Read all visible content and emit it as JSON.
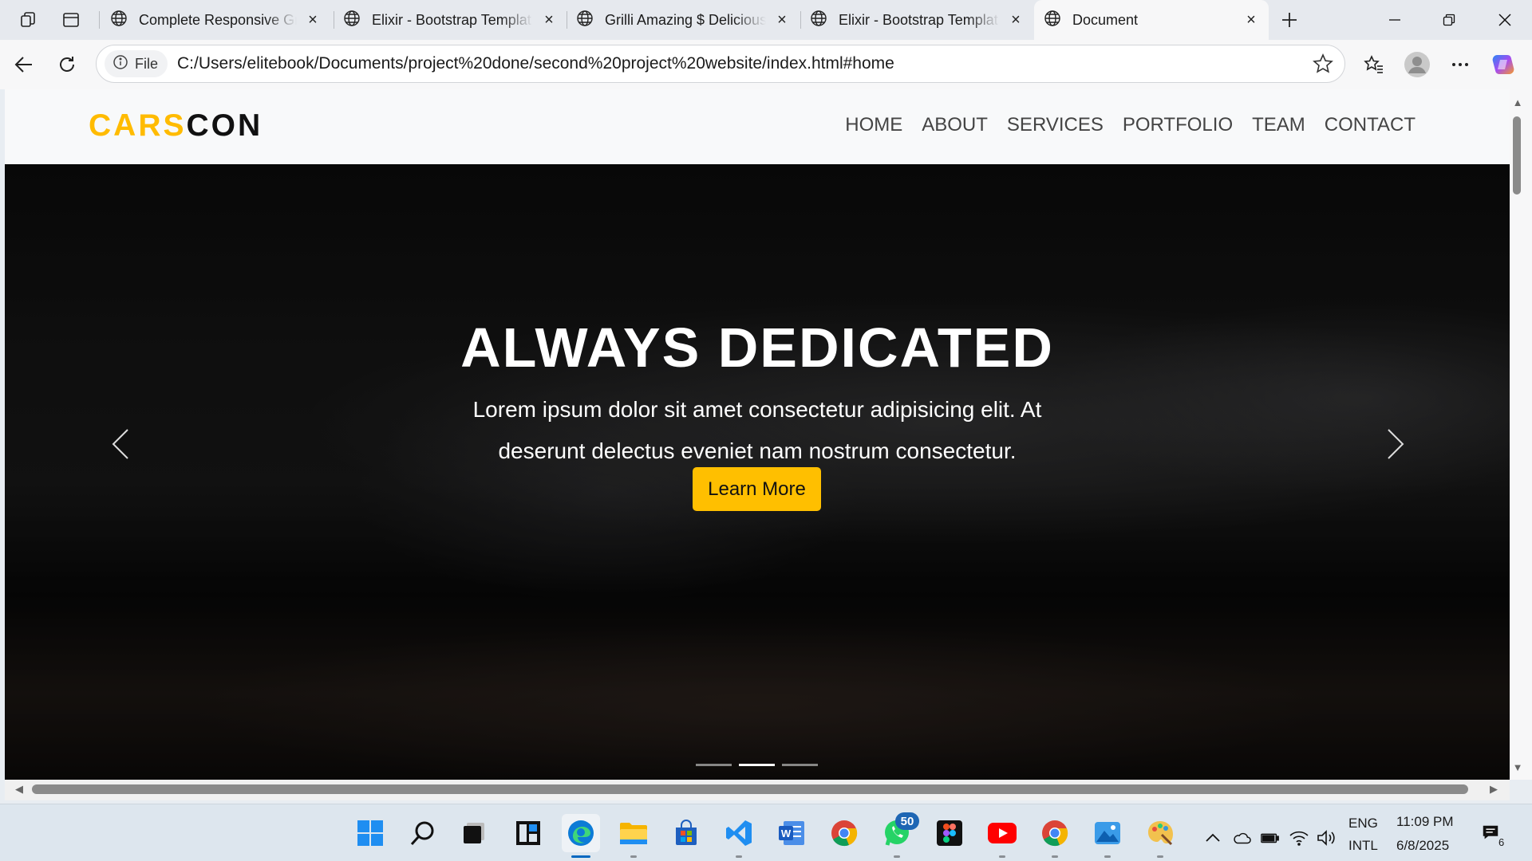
{
  "browser": {
    "tabs": [
      {
        "title": "Complete Responsive Gro",
        "active": false
      },
      {
        "title": "Elixir - Bootstrap Templat",
        "active": false
      },
      {
        "title": "Grilli Amazing $ Delicious",
        "active": false
      },
      {
        "title": "Elixir - Bootstrap Templat",
        "active": false
      },
      {
        "title": "Document",
        "active": true
      }
    ],
    "site_info_label": "File",
    "url": "C:/Users/elitebook/Documents/project%20done/second%20project%20website/index.html#home"
  },
  "site": {
    "logo_part1": "CARS",
    "logo_part2": "CON",
    "nav": [
      "HOME",
      "ABOUT",
      "SERVICES",
      "PORTFOLIO",
      "TEAM",
      "CONTACT"
    ],
    "hero": {
      "title": "ALWAYS DEDICATED",
      "text": "Lorem ipsum dolor sit amet consectetur adipisicing elit. At deserunt delectus eveniet nam nostrum consectetur.",
      "button": "Learn More",
      "slides": 3,
      "active_slide": 2
    },
    "colors": {
      "accent": "#ffbb00",
      "button": "#ffbf00"
    }
  },
  "taskbar": {
    "apps": [
      "windows-start",
      "search",
      "task-view",
      "widgets",
      "edge",
      "file-explorer",
      "microsoft-store",
      "vscode",
      "word",
      "chrome",
      "whatsapp",
      "figma",
      "youtube",
      "chrome",
      "photos",
      "paint"
    ],
    "whatsapp_badge": "50",
    "language_line1": "ENG",
    "language_line2": "INTL",
    "time": "11:09 PM",
    "date": "6/8/2025",
    "notification_count": "6"
  }
}
